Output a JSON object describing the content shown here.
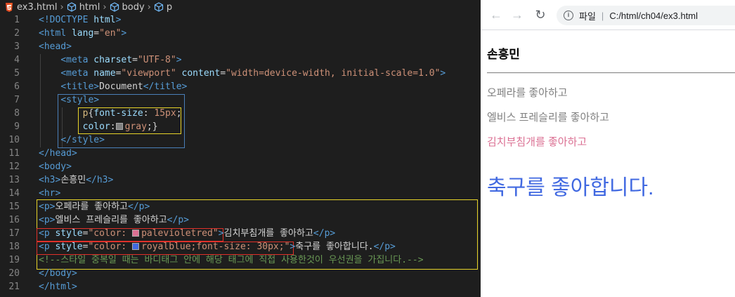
{
  "editor": {
    "breadcrumbs": [
      "ex3.html",
      "html",
      "body",
      "p"
    ],
    "lines": [
      {
        "n": "1"
      },
      {
        "n": "2"
      },
      {
        "n": "3"
      },
      {
        "n": "4"
      },
      {
        "n": "5"
      },
      {
        "n": "6"
      },
      {
        "n": "7"
      },
      {
        "n": "8"
      },
      {
        "n": "9"
      },
      {
        "n": "10"
      },
      {
        "n": "11"
      },
      {
        "n": "12"
      },
      {
        "n": "13"
      },
      {
        "n": "14"
      },
      {
        "n": "15"
      },
      {
        "n": "16"
      },
      {
        "n": "17"
      },
      {
        "n": "18"
      },
      {
        "n": "19"
      },
      {
        "n": "20"
      },
      {
        "n": "21"
      }
    ],
    "code": {
      "doctype": "html",
      "lang": "\"en\"",
      "charset": "\"UTF-8\"",
      "viewport_name": "\"viewport\"",
      "viewport_content": "\"width=device-width, initial-scale=1.0\"",
      "title": "Document",
      "css_selector": "p",
      "css_font_size": "15px",
      "css_color": "gray",
      "h3": "손흥민",
      "p1": "오페라를 좋아하고",
      "p2": "엘비스 프레슬리를 좋아하고",
      "p3_style": "\"color: ",
      "p3_color": "palevioletred",
      "p3_text": "김치부침개를 좋아하고",
      "p4_style": "\"color: ",
      "p4_color": "royalblue;font-size: 30px;\"",
      "p4_text": "축구를 좋아합니다.",
      "comment": "<!--스타일 중복일 때는 바디태그 안에 해당 태그에 직접 사용한것이 우선권을 가집니다.-->"
    },
    "colors": {
      "gray": "#808080",
      "palevioletred": "#db7093",
      "royalblue": "#4169e1"
    }
  },
  "browser": {
    "address_label": "파일",
    "address_path": "C:/html/ch04/ex3.html",
    "h3": "손흥민",
    "paragraphs": [
      {
        "text": "오페라를 좋아하고",
        "color": "gray"
      },
      {
        "text": "엘비스 프레슬리를 좋아하고",
        "color": "gray"
      },
      {
        "text": "김치부침개를 좋아하고",
        "color": "#db7093"
      },
      {
        "text": "축구를 좋아합니다.",
        "color": "#4169e1"
      }
    ]
  }
}
